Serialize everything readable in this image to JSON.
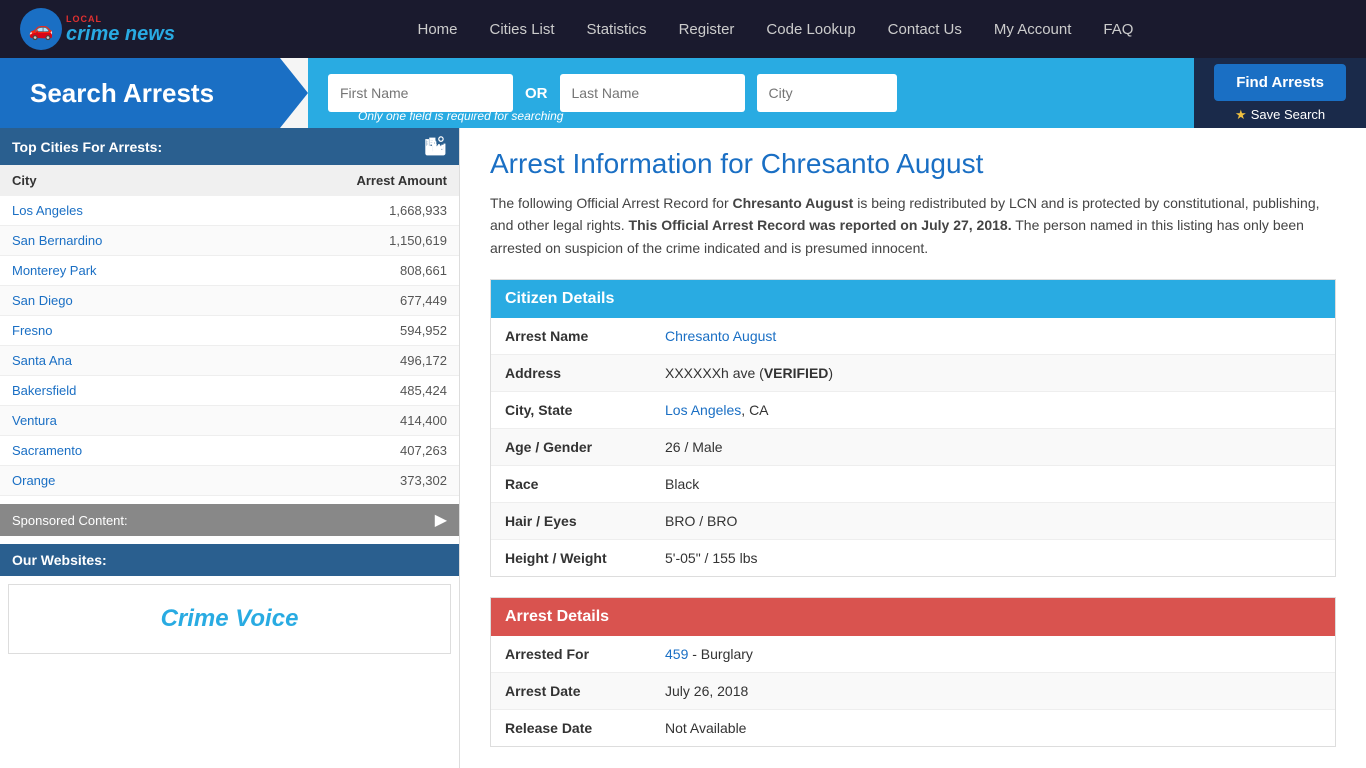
{
  "nav": {
    "logo_text": "crime news",
    "logo_local": "LOCAL",
    "links": [
      {
        "label": "Home",
        "name": "home"
      },
      {
        "label": "Cities List",
        "name": "cities-list"
      },
      {
        "label": "Statistics",
        "name": "statistics"
      },
      {
        "label": "Register",
        "name": "register"
      },
      {
        "label": "Code Lookup",
        "name": "code-lookup"
      },
      {
        "label": "Contact Us",
        "name": "contact-us"
      },
      {
        "label": "My Account",
        "name": "my-account"
      },
      {
        "label": "FAQ",
        "name": "faq"
      }
    ]
  },
  "search": {
    "title": "Search Arrests",
    "first_name_placeholder": "First Name",
    "last_name_placeholder": "Last Name",
    "city_placeholder": "City",
    "or_text": "OR",
    "hint": "Only one field is required for searching",
    "find_button": "Find Arrests",
    "save_search": "Save Search"
  },
  "sidebar": {
    "top_cities_title": "Top Cities For Arrests:",
    "columns": [
      "City",
      "Arrest Amount"
    ],
    "cities": [
      {
        "name": "Los Angeles",
        "amount": "1,668,933"
      },
      {
        "name": "San Bernardino",
        "amount": "1,150,619"
      },
      {
        "name": "Monterey Park",
        "amount": "808,661"
      },
      {
        "name": "San Diego",
        "amount": "677,449"
      },
      {
        "name": "Fresno",
        "amount": "594,952"
      },
      {
        "name": "Santa Ana",
        "amount": "496,172"
      },
      {
        "name": "Bakersfield",
        "amount": "485,424"
      },
      {
        "name": "Ventura",
        "amount": "414,400"
      },
      {
        "name": "Sacramento",
        "amount": "407,263"
      },
      {
        "name": "Orange",
        "amount": "373,302"
      }
    ],
    "sponsored_label": "Sponsored Content:",
    "our_websites_label": "Our Websites:",
    "crime_voice_text": "Crime Voice"
  },
  "main": {
    "page_title": "Arrest Information for Chresanto August",
    "intro": "The following Official Arrest Record for ",
    "subject_name": "Chresanto August",
    "intro_mid": " is being redistributed by LCN and is protected by constitutional, publishing, and other legal rights. ",
    "report_bold": "This Official Arrest Record was reported on July 27, 2018.",
    "intro_end": " The person named in this listing has only been arrested on suspicion of the crime indicated and is presumed innocent.",
    "citizen_details_title": "Citizen Details",
    "arrest_details_title": "Arrest Details",
    "fields": {
      "arrest_name_label": "Arrest Name",
      "arrest_name_value": "Chresanto August",
      "address_label": "Address",
      "address_value": "XXXXXXh ave (",
      "verified_text": "VERIFIED",
      "address_end": ")",
      "city_state_label": "City, State",
      "city_value": "Los Angeles",
      "state_value": ", CA",
      "age_gender_label": "Age / Gender",
      "age_gender_value": "26 / Male",
      "race_label": "Race",
      "race_value": "Black",
      "hair_eyes_label": "Hair / Eyes",
      "hair_eyes_value": "BRO / BRO",
      "height_weight_label": "Height / Weight",
      "height_weight_value": "5'-05\" / 155 lbs",
      "arrested_for_label": "Arrested For",
      "arrested_for_link": "459",
      "arrested_for_value": " - Burglary",
      "arrest_date_label": "Arrest Date",
      "arrest_date_value": "July 26, 2018",
      "release_date_label": "Release Date",
      "release_date_value": "Not Available"
    }
  },
  "colors": {
    "nav_bg": "#1a1a2e",
    "blue_accent": "#29abe2",
    "dark_blue": "#1a6fc4",
    "sidebar_header": "#2a5f8f",
    "red": "#d9534f",
    "link_color": "#1a6fc4"
  }
}
